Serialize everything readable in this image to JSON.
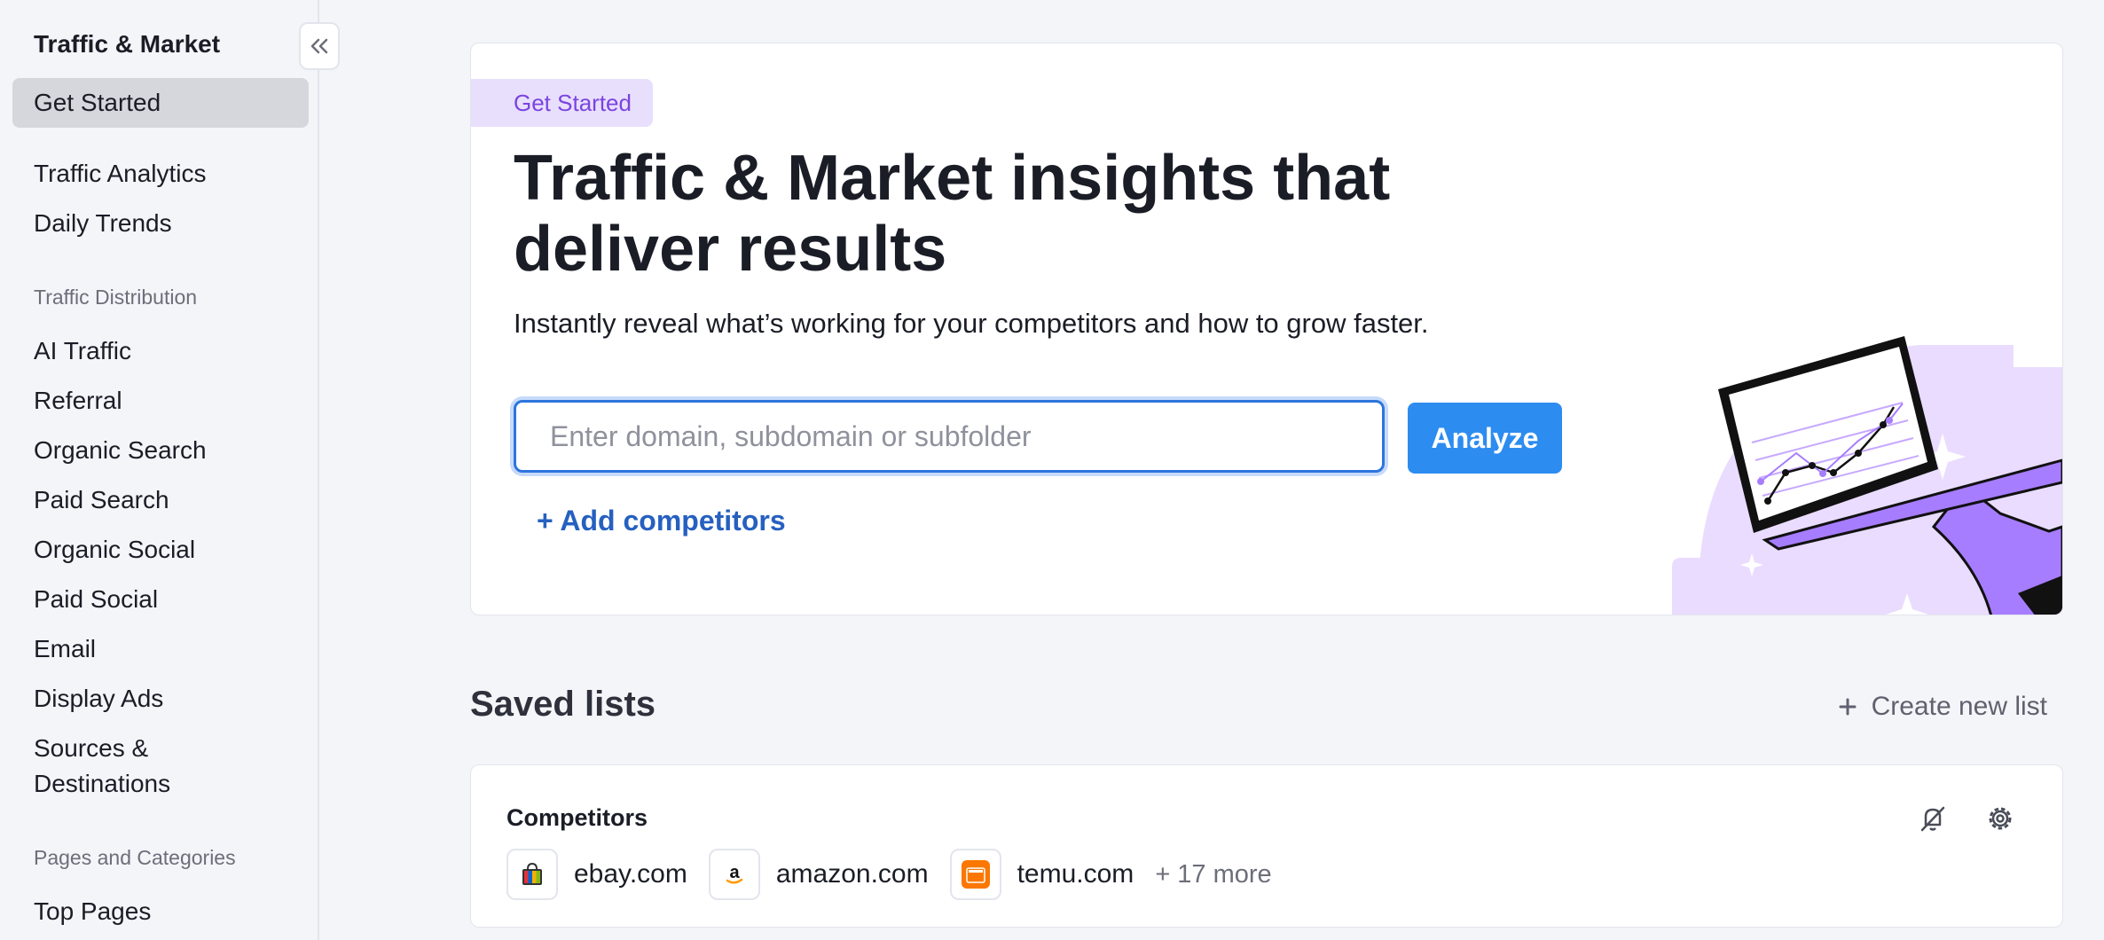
{
  "sidebar": {
    "title": "Traffic & Market",
    "active": "Get Started",
    "items_top": [
      "Traffic Analytics",
      "Daily Trends"
    ],
    "section_distribution": "Traffic Distribution",
    "items_distribution": [
      "AI Traffic",
      "Referral",
      "Organic Search",
      "Paid Search",
      "Organic Social",
      "Paid Social",
      "Email",
      "Display Ads"
    ],
    "sources_line1": "Sources &",
    "sources_line2": "Destinations",
    "section_pages": "Pages and Categories",
    "items_pages": [
      "Top Pages"
    ]
  },
  "hero": {
    "tag": "Get Started",
    "title_line1": "Traffic & Market insights that",
    "title_line2": "deliver results",
    "subtitle": "Instantly reveal what’s working for your competitors and how to grow faster.",
    "input_placeholder": "Enter domain, subdomain or subfolder",
    "analyze_label": "Analyze",
    "add_competitors": "+ Add competitors"
  },
  "saved_lists": {
    "title": "Saved lists",
    "create_label": "Create new list",
    "lists": [
      {
        "name": "Competitors",
        "domains": [
          "ebay.com",
          "amazon.com",
          "temu.com"
        ],
        "more": "+ 17 more"
      }
    ]
  },
  "colors": {
    "accent": "#2d8cf0",
    "link": "#2660c0",
    "tag_bg": "#e8dffd",
    "tag_text": "#7a44e0"
  }
}
